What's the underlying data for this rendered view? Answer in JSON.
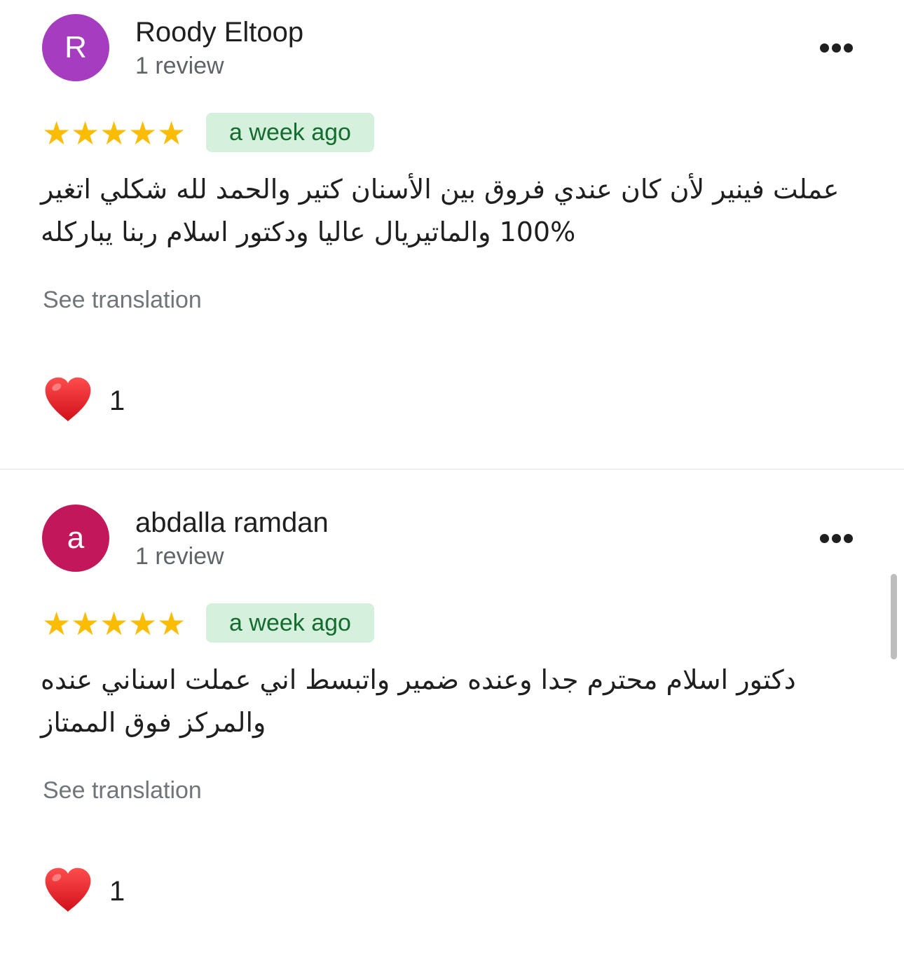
{
  "colors": {
    "star": "#fbbc04",
    "badge_bg": "#d5f0dc",
    "badge_text": "#146c2e",
    "heart": "#e8232a"
  },
  "reviews": [
    {
      "avatar_letter": "R",
      "avatar_color": "#a63cbf",
      "author": "Roody Eltoop",
      "review_count": "1 review",
      "rating": 5,
      "time_ago": "a week ago",
      "text_lines": [
        "عملت فينير لأن كان عندي فروق بين الأسنان كتير والحمد لله شكلي اتغير",
        "100% والماتيريال عاليا ودكتور اسلام ربنا يباركله"
      ],
      "see_translation": "See translation",
      "reaction_icon": "heart-icon",
      "reaction_count": "1"
    },
    {
      "avatar_letter": "a",
      "avatar_color": "#c2185b",
      "author": "abdalla ramdan",
      "review_count": "1 review",
      "rating": 5,
      "time_ago": "a week ago",
      "text_lines": [
        "دكتور اسلام محترم جدا وعنده ضمير واتبسط اني عملت اسناني عنده",
        "والمركز فوق الممتاز"
      ],
      "see_translation": "See translation",
      "reaction_icon": "heart-icon",
      "reaction_count": "1"
    }
  ]
}
